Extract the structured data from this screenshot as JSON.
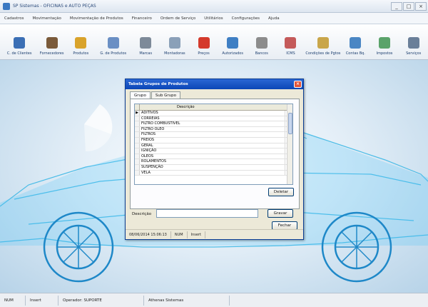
{
  "window": {
    "title": "SP Sistemas - OFICINAS e AUTO PEÇAS"
  },
  "menu": [
    "Cadastros",
    "Movimentação",
    "Movimentação de Produtos",
    "Financeiro",
    "Ordem de Serviço",
    "Utilitários",
    "Configurações",
    "Ajuda"
  ],
  "toolbar": [
    {
      "label": "C. de Clientes",
      "icon": "clients-icon",
      "color": "#3b6fb5"
    },
    {
      "label": "Fornecedores",
      "icon": "suppliers-icon",
      "color": "#7a5a3a"
    },
    {
      "label": "Produtos",
      "icon": "products-icon",
      "color": "#d9a32b"
    },
    {
      "label": "G. de Produtos",
      "icon": "product-groups-icon",
      "color": "#6a8fc4"
    },
    {
      "label": "Marcas",
      "icon": "brands-icon",
      "color": "#7d8a99"
    },
    {
      "label": "Montadoras",
      "icon": "assemblers-icon",
      "color": "#8aa0b8"
    },
    {
      "label": "Preços",
      "icon": "price-tag-icon",
      "color": "#d43a2c"
    },
    {
      "label": "Autorizados",
      "icon": "authorized-icon",
      "color": "#3f7fc4"
    },
    {
      "label": "Bancos",
      "icon": "bank-icon",
      "color": "#8c8c8c"
    },
    {
      "label": "ICMS",
      "icon": "tax-icon",
      "color": "#c45a5a"
    },
    {
      "label": "Condições de Pgtos",
      "icon": "payment-conditions-icon",
      "color": "#c9a64a"
    },
    {
      "label": "Contas Bq.",
      "icon": "bank-accounts-icon",
      "color": "#4a86c4"
    },
    {
      "label": "Impostos",
      "icon": "taxes-icon",
      "color": "#5aa36a"
    },
    {
      "label": "Serviços",
      "icon": "services-icon",
      "color": "#6a7f99"
    }
  ],
  "dialog": {
    "title": "Tabela Grupos de Produtos",
    "tabs": [
      "Grupo",
      "Sub Grupo"
    ],
    "column_header": "Descrição",
    "rows": [
      "ADITIVOS",
      "CORREIAS",
      "FILTRO COMBUSTIVEL",
      "FILTRO OLEO",
      "FILTROS",
      "FREIOS",
      "GERAL",
      "IGNIÇÃO",
      "OLEOS",
      "ROLAMENTOS",
      "SUSPENÇÃO",
      "VELA"
    ],
    "selected_indicator": "▶",
    "delete_button": "Deletar",
    "description_label": "Descrição",
    "description_value": "",
    "save_button": "Gravar",
    "close_button": "Fechar",
    "status": {
      "datetime": "08/06/2014 15:06:13",
      "numlock": "NUM",
      "insert": "Insert"
    }
  },
  "statusbar": {
    "num": "NUM",
    "insert": "Insert",
    "operator": "Operador: SUPORTE",
    "company": "Athenas Sistemas"
  }
}
